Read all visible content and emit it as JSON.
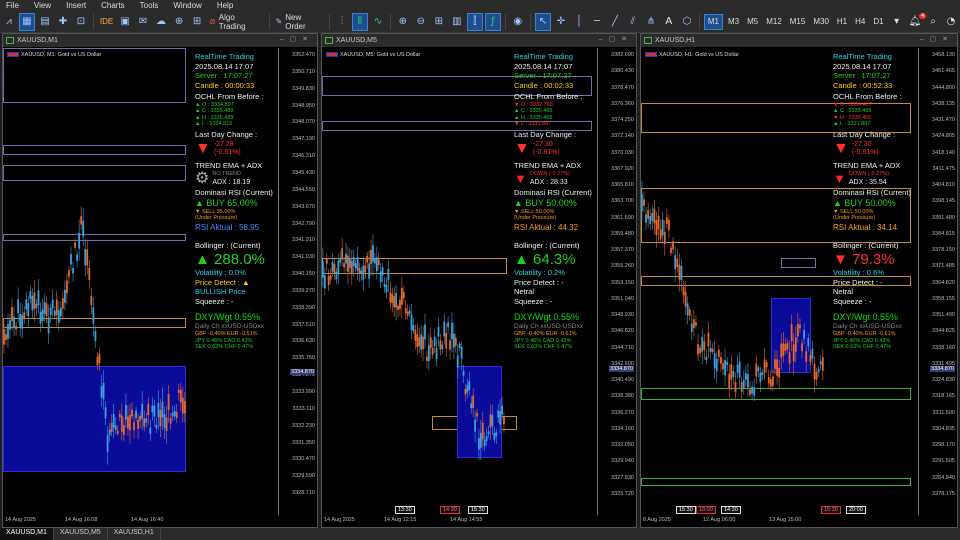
{
  "menu": [
    "File",
    "View",
    "Insert",
    "Charts",
    "Tools",
    "Window",
    "Help"
  ],
  "toolbar": {
    "ide": "IDE",
    "algo": "Algo Trading",
    "new_order": "New Order",
    "timeframes": [
      "M1",
      "M3",
      "M5",
      "M12",
      "M15",
      "M30",
      "H1",
      "H4",
      "D1"
    ],
    "active_tf": "M1",
    "notification_badge": "4"
  },
  "windows": [
    {
      "title": "XAUUSD,M1",
      "symbol_label": "XAUUSD, M1:  Gold vs US Dollar",
      "price_labels": [
        "3352.470",
        "3350.710",
        "3349.830",
        "3348.950",
        "3348.070",
        "3347.190",
        "3346.310",
        "3345.430",
        "3344.550",
        "3343.670",
        "3342.790",
        "3341.910",
        "3341.030",
        "3340.150",
        "3339.270",
        "3338.390",
        "3337.510",
        "3336.630",
        "3335.750",
        "3334.870",
        "3333.990",
        "3333.110",
        "3332.230",
        "3331.350",
        "3330.470",
        "3329.590",
        "3328.710"
      ],
      "current_price": "3334.870",
      "time_labels": [
        "14 Aug 2025",
        "14 Aug 16:08",
        "14 Aug 16:40"
      ],
      "panel": {
        "rt": "RealTime Trading",
        "date": "2025.08.14 17:07",
        "server": "Server  : 17:07:27",
        "candle": "Candle : 00:00:33",
        "ochl_title": "OCHL From Before :",
        "o": "▲ O : 3334.807",
        "c": "▲ C : 3335.489",
        "h": "▲ H : 3335.489",
        "l": "▲ L : 3334.515",
        "o_col": "green",
        "c_col": "green",
        "h_col": "green",
        "l_col": "green",
        "ldc": "Last Day Change :",
        "ldc1": "-27.28",
        "ldc2": "(-0.81%)",
        "trend": "TREND EMA + ADX",
        "trend_state": "NO TREND",
        "adx": "ADX : 18.19",
        "dom": "Dominasi RSI (Current)",
        "buy": "▲ BUY 65.00%",
        "sell": "▼ SELL 35.00%",
        "sell_note": "(Under Pressure)",
        "rsi": "RSI Aktual : 58.95",
        "rsi_col": "blue",
        "boll": "Bollinger : (Current)",
        "boll_val": "▲ 288.0%",
        "boll_col": "green",
        "vol": "Volatility : 0.0%",
        "detect": "Price Detect :  ▲",
        "detect2": "BULLISH Price",
        "squeeze": "Squeeze : -",
        "dxy": "DXY/Wgt 0.55%",
        "daily": "Daily Ch xxUSD-USDxx",
        "fx1": "GBP  -0.40%   EUR  -0.61%",
        "fx2": "JPY   0.46%   CAD   0.43%",
        "fx3": "SEK   0.63%   CHF   0.47%"
      }
    },
    {
      "title": "XAUUSD,M5",
      "symbol_label": "XAUUSD, M5:  Gold vs US Dollar",
      "price_labels": [
        "3382.690",
        "3380.430",
        "3378.470",
        "3376.360",
        "3374.250",
        "3372.140",
        "3370.030",
        "3367.920",
        "3365.810",
        "3363.700",
        "3361.590",
        "3359.480",
        "3357.370",
        "3355.260",
        "3353.150",
        "3351.040",
        "3348.930",
        "3346.820",
        "3344.710",
        "3342.600",
        "3340.490",
        "3338.380",
        "3336.270",
        "3334.160",
        "3332.050",
        "3329.940",
        "3327.830",
        "3325.720"
      ],
      "current_price": "3334.870",
      "time_labels": [
        "14 Aug 2025",
        "14 Aug 12:15",
        "14 Aug 14:55"
      ],
      "news_tags": [
        "13:30",
        "14:30",
        "15:30"
      ],
      "panel": {
        "rt": "RealTime Trading",
        "date": "2025.08.14 17:07",
        "server": "Server  : 17:07:27",
        "candle": "Candle : 00:02:33",
        "ochl_title": "OCHL From Before :",
        "o": "▼ O : 3332.768",
        "c": "▲ C : 3335.465",
        "h": "▲ H : 3335.465",
        "l": "▼ L : 3331.887",
        "o_col": "red",
        "c_col": "green",
        "h_col": "green",
        "l_col": "red",
        "ldc": "Last Day Change :",
        "ldc1": "-27.30",
        "ldc2": "(-0.81%)",
        "trend": "TREND EMA + ADX",
        "trend_state": "DOWN (-0.27%)",
        "adx": "ADX : 28.33",
        "dom": "Dominasi RSI (Current)",
        "buy": "▲ BUY 50.00%",
        "sell": "▼ SELL 50.00%",
        "sell_note": "(Under Pressure)",
        "rsi": "RSI Aktual : 44.32",
        "rsi_col": "orange",
        "boll": "Bollinger : (Current)",
        "boll_val": "▲ 64.3%",
        "boll_col": "green",
        "vol": "Volatility : 0.2%",
        "detect": "Price Detect : -",
        "detect2": "Netral",
        "squeeze": "Squeeze : -",
        "dxy": "DXY/Wgt 0.55%",
        "daily": "Daily Ch xxUSD-USDxx",
        "fx1": "GBP  -0.40%   EUR  -0.61%",
        "fx2": "JPY   0.46%   CAD   0.43%",
        "fx3": "SEK   0.63%   CHF   0.47%"
      }
    },
    {
      "title": "XAUUSD,H1",
      "symbol_label": "XAUUSD, H1:  Gold vs US Dollar",
      "price_labels": [
        "3458.130",
        "3451.465",
        "3444.800",
        "3438.135",
        "3431.470",
        "3424.805",
        "3418.140",
        "3411.475",
        "3404.810",
        "3398.145",
        "3391.480",
        "3384.815",
        "3378.150",
        "3371.485",
        "3364.820",
        "3358.155",
        "3351.490",
        "3344.825",
        "3338.160",
        "3331.495",
        "3324.830",
        "3318.165",
        "3311.500",
        "3304.835",
        "3298.170",
        "3291.505",
        "3284.840",
        "3278.175"
      ],
      "current_price": "3334.870",
      "time_labels": [
        "8 Aug 2025",
        "12 Aug 06:00",
        "13 Aug 15:00"
      ],
      "news_tags": [
        "15:30",
        "18:00",
        "14:30",
        "15:30",
        "20:00"
      ],
      "panel": {
        "rt": "RealTime Trading",
        "date": "2025.08.14 17:07",
        "server": "Server  : 17:07:27",
        "candle": "Candle : 00:52:33",
        "ochl_title": "OCHL From Before :",
        "o": "▼ O : 3334.407",
        "c": "▲ C : 3335.465",
        "h": "▼ H : 3336.465",
        "l": "▲ L : 3331.887",
        "o_col": "red",
        "c_col": "green",
        "h_col": "red",
        "l_col": "green",
        "ldc": "Last Day Change :",
        "ldc1": "-27.30",
        "ldc2": "(-0.81%)",
        "trend": "TREND EMA + ADX",
        "trend_state": "DOWN (-0.27%)",
        "adx": "ADX : 35.54",
        "dom": "Dominasi RSI (Current)",
        "buy": "▲ BUY 50.00%",
        "sell": "▼ SELL 50.00%",
        "sell_note": "(Under Pressure)",
        "rsi": "RSI Aktual : 34.14",
        "rsi_col": "orange",
        "boll": "Bollinger : (Current)",
        "boll_val": "▼ 79.3%",
        "boll_col": "red",
        "vol": "Volatility : 0.6%",
        "detect": "Price Detect : -",
        "detect2": "Netral",
        "squeeze": "Squeeze : -",
        "dxy": "DXY/Wgt 0.55%",
        "daily": "Daily Ch xxUSD-USDxx",
        "fx1": "GBP  -0.40%   EUR  -0.61%",
        "fx2": "JPY   0.46%   CAD   0.43%",
        "fx3": "SEK   0.63%   CHF   0.47%"
      }
    }
  ],
  "tabs": [
    "XAUUSD,M1",
    "XAUUSD,M5",
    "XAUUSD,H1"
  ],
  "active_tab": "XAUUSD,M1"
}
